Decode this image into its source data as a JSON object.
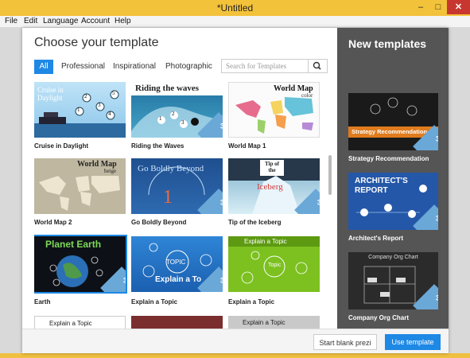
{
  "window": {
    "title": "*Untitled",
    "controls": {
      "minimize": "–",
      "maximize": "□",
      "close": "✕"
    }
  },
  "menu": [
    "File",
    "Edit",
    "Language",
    "Account",
    "Help"
  ],
  "dialog": {
    "heading": "Choose your template",
    "filters": [
      "All",
      "Professional",
      "Inspirational",
      "Photographic"
    ],
    "active_filter": "All",
    "search": {
      "placeholder": "Search for Templates",
      "icon": "search-icon"
    },
    "templates": [
      {
        "label": "Cruise in Daylight",
        "caption": "Cruise in\nDaylight",
        "nums": [
          "1",
          "2",
          "3",
          "4",
          "5"
        ]
      },
      {
        "label": "Riding the Waves",
        "caption": "Riding the waves",
        "nums": [
          "1",
          "2",
          "3"
        ],
        "badge": "3D"
      },
      {
        "label": "World Map 1",
        "caption": "World Map",
        "subcaption": "color"
      },
      {
        "label": "World Map 2",
        "caption": "World Map",
        "subcaption": "beige"
      },
      {
        "label": "Go Boldly Beyond",
        "caption": "Go Boldly Beyond",
        "badge": "3D"
      },
      {
        "label": "Tip of the Iceberg",
        "caption": "Iceberg",
        "subcaption": "Tip of the",
        "badge": "3D"
      },
      {
        "label": "Earth",
        "caption": "Planet Earth",
        "badge": "3D"
      },
      {
        "label": "Explain a Topic",
        "caption": "Explain a To",
        "topic": "TOPIC",
        "badge": "3D"
      },
      {
        "label": "Explain a Topic",
        "caption": "Explain a Topic",
        "topic": "Topic"
      },
      {
        "label": "",
        "caption": "Explain a Topic"
      },
      {
        "label": "",
        "caption": ""
      },
      {
        "label": "",
        "caption": "Explain a Topic"
      }
    ],
    "side_panel": {
      "heading": "New templates",
      "templates": [
        {
          "label": "Strategy Recommendation",
          "caption": "Strategy Recommendation",
          "badge": "3D"
        },
        {
          "label": "Architect's Report",
          "caption": "ARCHITECT'S REPORT",
          "badge": "3D"
        },
        {
          "label": "Company Org Chart",
          "caption": "Company Org Chart",
          "badge": "3D"
        }
      ]
    },
    "buttons": {
      "blank": "Start blank prezi",
      "use": "Use template"
    }
  }
}
